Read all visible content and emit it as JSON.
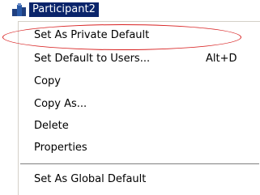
{
  "tree_node": {
    "label": "Participant2",
    "icon": "participant-node-icon"
  },
  "context_menu": {
    "items": [
      {
        "label": "Set As Private Default",
        "shortcut": ""
      },
      {
        "label": "Set Default to Users...",
        "shortcut": "Alt+D"
      },
      {
        "label": "Copy",
        "shortcut": ""
      },
      {
        "label": "Copy As...",
        "shortcut": ""
      },
      {
        "label": "Delete",
        "shortcut": ""
      },
      {
        "label": "Properties",
        "shortcut": ""
      }
    ],
    "footer_item": {
      "label": "Set As Global Default"
    }
  },
  "annotation": {
    "color": "#d82020",
    "shape": "ellipse",
    "target": "Set As Private Default"
  },
  "colors": {
    "selection": "#0a246a",
    "selection_text": "#ffffff"
  }
}
